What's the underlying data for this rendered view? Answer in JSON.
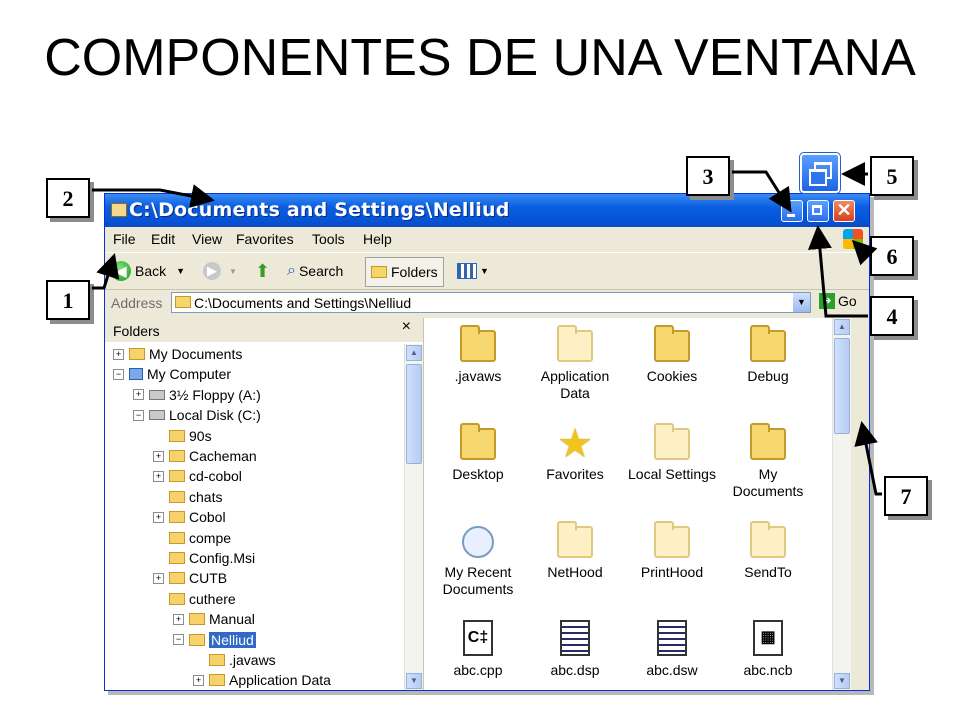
{
  "slide": {
    "title": "COMPONENTES DE UNA VENTANA"
  },
  "window": {
    "title": "C:\\Documents and Settings\\Nelliud",
    "menu": [
      "File",
      "Edit",
      "View",
      "Favorites",
      "Tools",
      "Help"
    ],
    "toolbar": {
      "back": "Back",
      "search": "Search",
      "folders": "Folders"
    },
    "address": {
      "label": "Address",
      "value": "C:\\Documents and Settings\\Nelliud",
      "go": "Go"
    },
    "tree": {
      "header": "Folders",
      "close": "×",
      "items": [
        {
          "label": "My Documents",
          "level": 0,
          "expander": "+",
          "icon": "my-documents-icon"
        },
        {
          "label": "My Computer",
          "level": 0,
          "expander": "−",
          "icon": "my-computer-icon"
        },
        {
          "label": "3½ Floppy (A:)",
          "level": 1,
          "expander": "+",
          "icon": "floppy-drive-icon"
        },
        {
          "label": "Local Disk (C:)",
          "level": 1,
          "expander": "−",
          "icon": "local-disk-icon"
        },
        {
          "label": "90s",
          "level": 2,
          "expander": "",
          "icon": "folder-icon"
        },
        {
          "label": "Cacheman",
          "level": 2,
          "expander": "+",
          "icon": "folder-icon"
        },
        {
          "label": "cd-cobol",
          "level": 2,
          "expander": "+",
          "icon": "folder-icon"
        },
        {
          "label": "chats",
          "level": 2,
          "expander": "",
          "icon": "folder-icon"
        },
        {
          "label": "Cobol",
          "level": 2,
          "expander": "+",
          "icon": "folder-icon"
        },
        {
          "label": "compe",
          "level": 2,
          "expander": "",
          "icon": "folder-icon"
        },
        {
          "label": "Config.Msi",
          "level": 2,
          "expander": "",
          "icon": "folder-icon"
        },
        {
          "label": "CUTB",
          "level": 2,
          "expander": "+",
          "icon": "folder-icon"
        },
        {
          "label": "cuthere",
          "level": 2,
          "expander": "",
          "icon": "folder-icon"
        },
        {
          "label": "Manual",
          "level": 3,
          "expander": "+",
          "icon": "folder-icon"
        },
        {
          "label": "Nelliud",
          "level": 3,
          "expander": "−",
          "icon": "folder-icon",
          "selected": true
        },
        {
          "label": ".javaws",
          "level": 4,
          "expander": "",
          "icon": "folder-icon"
        },
        {
          "label": "Application Data",
          "level": 4,
          "expander": "+",
          "icon": "folder-icon"
        }
      ]
    },
    "files": [
      {
        "label": ".javaws",
        "icon": "folder"
      },
      {
        "label": "Application Data",
        "icon": "folder-pale"
      },
      {
        "label": "Cookies",
        "icon": "folder"
      },
      {
        "label": "Debug",
        "icon": "folder"
      },
      {
        "label": "Desktop",
        "icon": "folder"
      },
      {
        "label": "Favorites",
        "icon": "star"
      },
      {
        "label": "Local Settings",
        "icon": "folder-pale"
      },
      {
        "label": "My Documents",
        "icon": "folder"
      },
      {
        "label": "My Recent Documents",
        "icon": "recent"
      },
      {
        "label": "NetHood",
        "icon": "folder-pale"
      },
      {
        "label": "PrintHood",
        "icon": "folder-pale"
      },
      {
        "label": "SendTo",
        "icon": "folder-pale"
      },
      {
        "label": "abc.cpp",
        "icon": "cpp"
      },
      {
        "label": "abc.dsp",
        "icon": "pages"
      },
      {
        "label": "abc.dsw",
        "icon": "pages"
      },
      {
        "label": "abc.ncb",
        "icon": "grid"
      }
    ]
  },
  "callouts": [
    "1",
    "2",
    "3",
    "4",
    "5",
    "6",
    "7"
  ]
}
